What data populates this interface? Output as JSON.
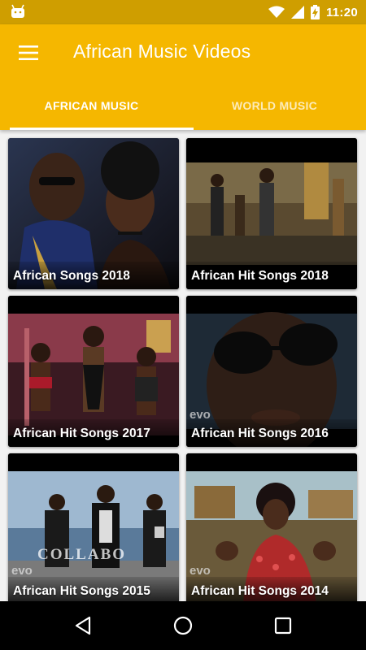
{
  "status_bar": {
    "time": "11:20",
    "background": "#cf9e00",
    "icons": [
      "android-icon",
      "wifi-icon",
      "signal-icon",
      "battery-charging-icon"
    ]
  },
  "app_bar": {
    "title": "African Music Videos",
    "menu_icon": "hamburger-menu-icon",
    "background": "#f5b700"
  },
  "tabs": [
    {
      "label": "AFRICAN MUSIC",
      "active": true
    },
    {
      "label": "WORLD MUSIC",
      "active": false
    }
  ],
  "playlists": [
    {
      "title": "African Songs 2018"
    },
    {
      "title": "African Hit Songs 2018"
    },
    {
      "title": "African Hit Songs 2017"
    },
    {
      "title": "African Hit Songs 2016",
      "watermark": "evo"
    },
    {
      "title": "African Hit Songs 2015",
      "watermark": "COLLABO",
      "watermark2": "evo"
    },
    {
      "title": "African Hit Songs 2014",
      "watermark": "evo"
    }
  ],
  "nav_bar": {
    "icons": [
      "back-icon",
      "home-icon",
      "recents-icon"
    ]
  }
}
